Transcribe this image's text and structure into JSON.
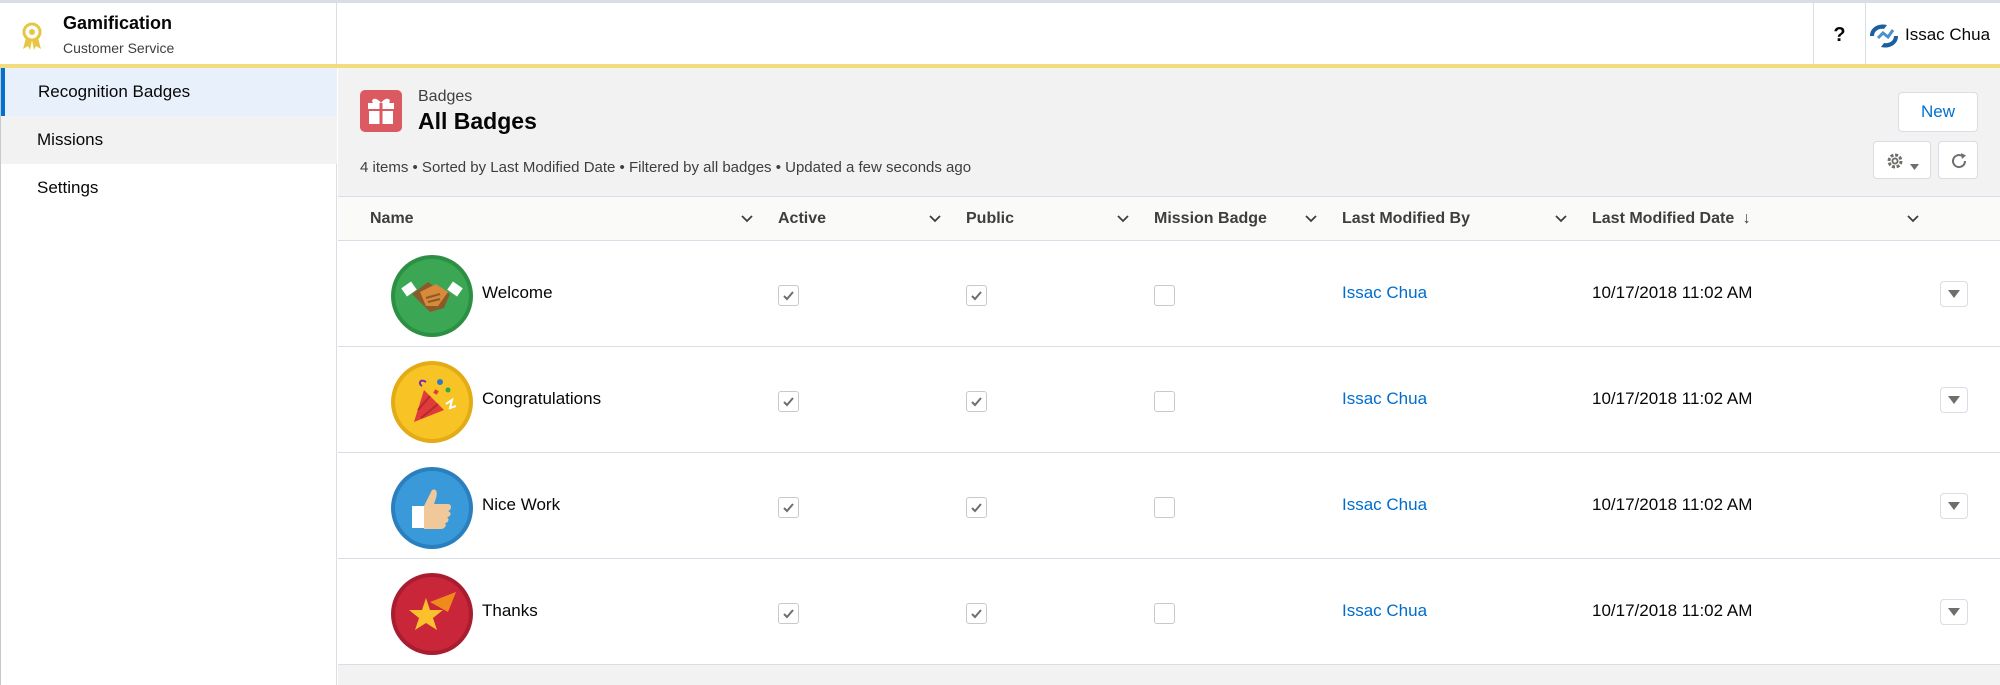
{
  "app": {
    "title": "Gamification",
    "subtitle": "Customer Service",
    "icon": "award-ribbon-icon",
    "accent_color": "#f2dc7e"
  },
  "header": {
    "help_label": "?",
    "user_name": "Issac Chua"
  },
  "sidebar": {
    "items": [
      {
        "label": "Recognition Badges",
        "active": true
      },
      {
        "label": "Missions",
        "active": false
      },
      {
        "label": "Settings",
        "active": false
      }
    ]
  },
  "list": {
    "object_label": "Badges",
    "title": "All Badges",
    "info": "4 items • Sorted by Last Modified Date • Filtered by all badges • Updated a few seconds ago",
    "new_button": "New",
    "icon": "gift-icon",
    "icon_color": "#db5a62"
  },
  "columns": {
    "name": "Name",
    "active": "Active",
    "public": "Public",
    "mission": "Mission Badge",
    "modified_by": "Last Modified By",
    "modified_date": "Last Modified Date",
    "sort_indicator": "↓"
  },
  "rows": [
    {
      "name": "Welcome",
      "active": true,
      "public": true,
      "mission": false,
      "modified_by": "Issac Chua",
      "modified_date": "10/17/2018 11:02 AM",
      "icon": "handshake-icon",
      "badge_color": "#3ba755"
    },
    {
      "name": "Congratulations",
      "active": true,
      "public": true,
      "mission": false,
      "modified_by": "Issac Chua",
      "modified_date": "10/17/2018 11:02 AM",
      "icon": "party-popper-icon",
      "badge_color": "#f7c325"
    },
    {
      "name": "Nice Work",
      "active": true,
      "public": true,
      "mission": false,
      "modified_by": "Issac Chua",
      "modified_date": "10/17/2018 11:02 AM",
      "icon": "thumbs-up-icon",
      "badge_color": "#3a9ad9"
    },
    {
      "name": "Thanks",
      "active": true,
      "public": true,
      "mission": false,
      "modified_by": "Issac Chua",
      "modified_date": "10/17/2018 11:02 AM",
      "icon": "shooting-star-icon",
      "badge_color": "#c9263a"
    }
  ]
}
